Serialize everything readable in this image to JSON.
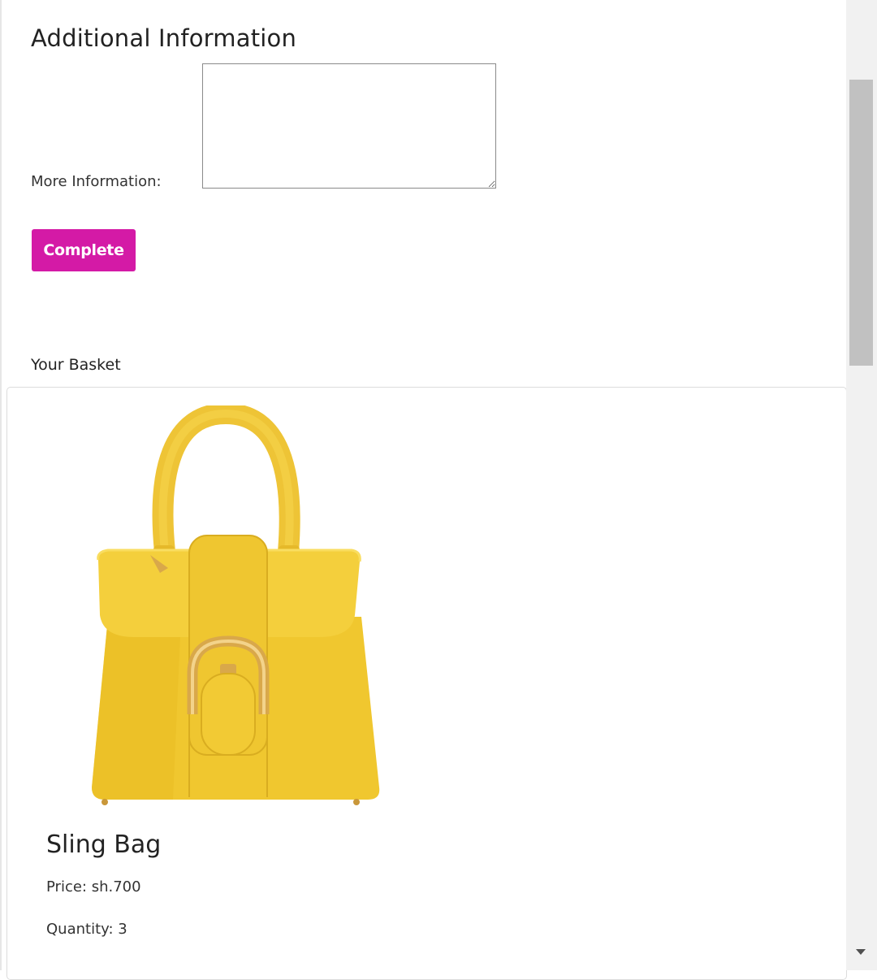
{
  "additional_info": {
    "title": "Additional Information",
    "more_info_label": "More Information:",
    "more_info_value": "",
    "complete_label": "Complete"
  },
  "basket": {
    "label": "Your Basket",
    "items": [
      {
        "name": "Sling Bag",
        "price": "Price: sh.700",
        "quantity": "Quantity: 3",
        "image_icon": "yellow-handbag-image"
      }
    ]
  },
  "colors": {
    "accent": "#d41aa6",
    "bag_yellow": "#f2cc33",
    "buckle_gold": "#d9a84a"
  }
}
